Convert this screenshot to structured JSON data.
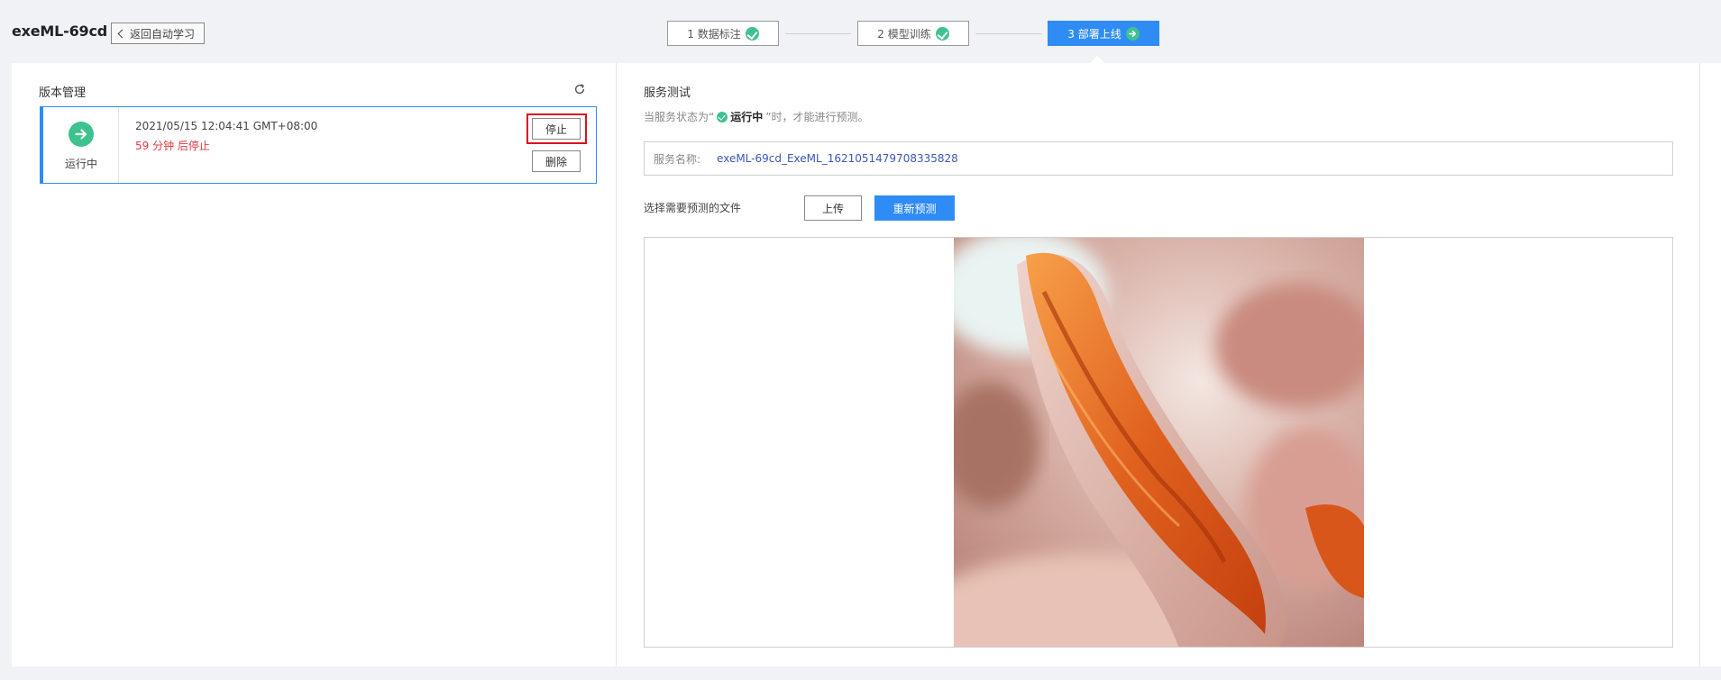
{
  "header": {
    "app_title": "exeML-69cd",
    "back_label": "返回自动学习",
    "steps": [
      {
        "label": "1 数据标注",
        "state": "done",
        "icon": "check-circle-icon"
      },
      {
        "label": "2 模型训练",
        "state": "done",
        "icon": "check-circle-icon"
      },
      {
        "label": "3 部署上线",
        "state": "active",
        "icon": "arrow-circle-icon"
      }
    ]
  },
  "version_panel": {
    "title": "版本管理",
    "card": {
      "status": "运行中",
      "timestamp": "2021/05/15 12:04:41 GMT+08:00",
      "stop_note": "59 分钟 后停止",
      "stop_label": "停止",
      "delete_label": "删除"
    }
  },
  "service_panel": {
    "title": "服务测试",
    "state_prefix": "当服务状态为“",
    "state_value": "运行中",
    "state_suffix": "”时，才能进行预测。",
    "service_name_label": "服务名称:",
    "service_name_value": "exeML-69cd_ExeML_1621051479708335828",
    "choose_file_label": "选择需要预测的文件",
    "upload_label": "上传",
    "repredict_label": "重新预测"
  },
  "colors": {
    "primary": "#2f8cf4",
    "success": "#3ec28f",
    "danger": "#e0383e",
    "highlight": "#d9141c",
    "link": "#3a57b8"
  }
}
